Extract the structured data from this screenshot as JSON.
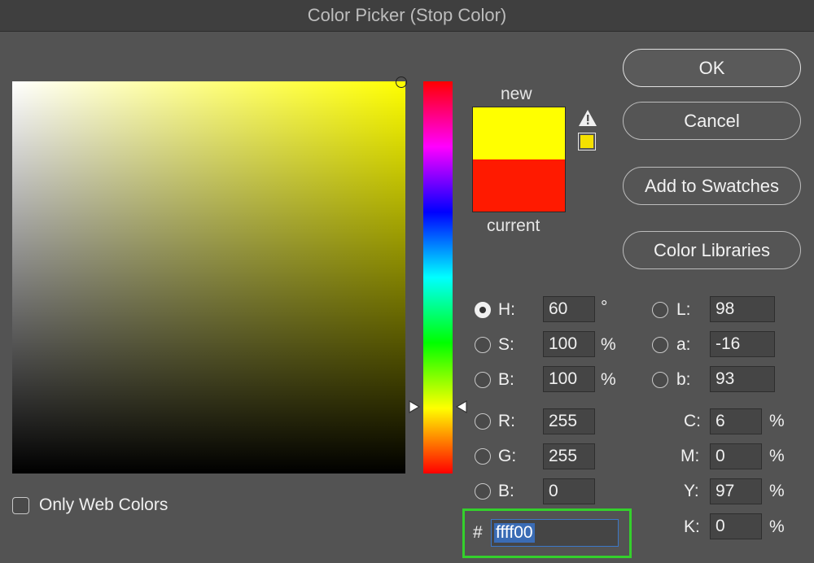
{
  "window": {
    "title": "Color Picker (Stop Color)"
  },
  "colors": {
    "new": "#ffff00",
    "current": "#ff1a00",
    "gamut_swatch": "#f5e100",
    "hex_highlight_border": "#34d02c"
  },
  "preview": {
    "new_label": "new",
    "current_label": "current",
    "warning_icon": "warning-triangle-icon"
  },
  "buttons": {
    "ok": "OK",
    "cancel": "Cancel",
    "add_to_swatches": "Add to Swatches",
    "color_libraries": "Color Libraries"
  },
  "hsb": {
    "h": {
      "label": "H:",
      "value": "60",
      "unit": "°",
      "selected": true
    },
    "s": {
      "label": "S:",
      "value": "100",
      "unit": "%"
    },
    "b": {
      "label": "B:",
      "value": "100",
      "unit": "%"
    }
  },
  "rgb": {
    "r": {
      "label": "R:",
      "value": "255"
    },
    "g": {
      "label": "G:",
      "value": "255"
    },
    "b": {
      "label": "B:",
      "value": "0"
    }
  },
  "lab": {
    "l": {
      "label": "L:",
      "value": "98"
    },
    "a": {
      "label": "a:",
      "value": "-16"
    },
    "b": {
      "label": "b:",
      "value": "93"
    }
  },
  "cmyk": {
    "c": {
      "label": "C:",
      "value": "6",
      "unit": "%"
    },
    "m": {
      "label": "M:",
      "value": "0",
      "unit": "%"
    },
    "y": {
      "label": "Y:",
      "value": "97",
      "unit": "%"
    },
    "k": {
      "label": "K:",
      "value": "0",
      "unit": "%"
    }
  },
  "hex": {
    "prefix": "#",
    "value": "ffff00"
  },
  "web_colors": {
    "label": "Only Web Colors",
    "checked": false
  }
}
